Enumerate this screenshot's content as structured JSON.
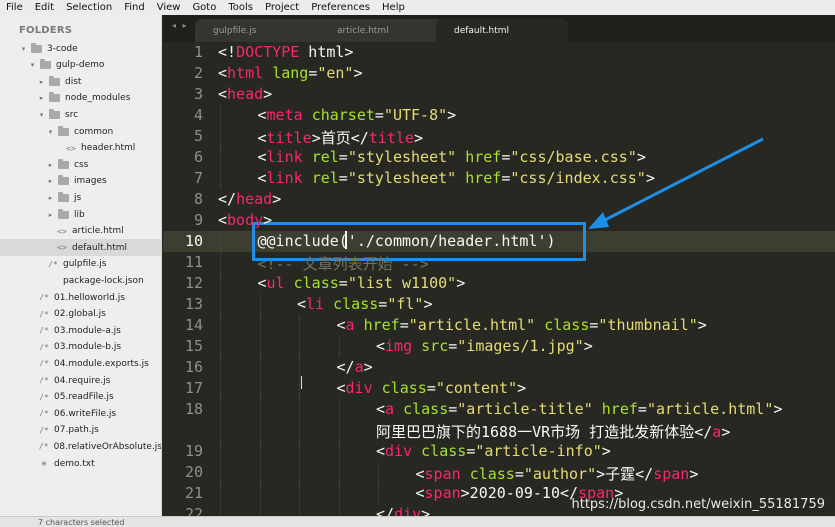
{
  "menu": [
    "File",
    "Edit",
    "Selection",
    "Find",
    "View",
    "Goto",
    "Tools",
    "Project",
    "Preferences",
    "Help"
  ],
  "sidebar": {
    "title": "FOLDERS",
    "items": [
      {
        "label": "3-code",
        "type": "folder",
        "arrow": "▾",
        "depth": 0
      },
      {
        "label": "gulp-demo",
        "type": "folder",
        "arrow": "▾",
        "depth": 1
      },
      {
        "label": "dist",
        "type": "folder",
        "arrow": "▸",
        "depth": 2
      },
      {
        "label": "node_modules",
        "type": "folder",
        "arrow": "▸",
        "depth": 2
      },
      {
        "label": "src",
        "type": "folder",
        "arrow": "▾",
        "depth": 2
      },
      {
        "label": "common",
        "type": "folder",
        "arrow": "▾",
        "depth": 3
      },
      {
        "label": "header.html",
        "type": "html",
        "icon": "<>",
        "depth": 4
      },
      {
        "label": "css",
        "type": "folder",
        "arrow": "▸",
        "depth": 3
      },
      {
        "label": "images",
        "type": "folder",
        "arrow": "▸",
        "depth": 3
      },
      {
        "label": "js",
        "type": "folder",
        "arrow": "▸",
        "depth": 3
      },
      {
        "label": "lib",
        "type": "folder",
        "arrow": "▸",
        "depth": 3
      },
      {
        "label": "article.html",
        "type": "html",
        "icon": "<>",
        "depth": 3
      },
      {
        "label": "default.html",
        "type": "html",
        "icon": "<>",
        "depth": 3,
        "selected": true
      },
      {
        "label": "gulpfile.js",
        "type": "js",
        "icon": "/*",
        "depth": 2
      },
      {
        "label": "package-lock.json",
        "type": "json",
        "icon": "",
        "depth": 2
      },
      {
        "label": "01.helloworld.js",
        "type": "js",
        "icon": "/*",
        "depth": 1
      },
      {
        "label": "02.global.js",
        "type": "js",
        "icon": "/*",
        "depth": 1
      },
      {
        "label": "03.module-a.js",
        "type": "js",
        "icon": "/*",
        "depth": 1
      },
      {
        "label": "03.module-b.js",
        "type": "js",
        "icon": "/*",
        "depth": 1
      },
      {
        "label": "04.module.exports.js",
        "type": "js",
        "icon": "/*",
        "depth": 1
      },
      {
        "label": "04.require.js",
        "type": "js",
        "icon": "/*",
        "depth": 1
      },
      {
        "label": "05.readFile.js",
        "type": "js",
        "icon": "/*",
        "depth": 1
      },
      {
        "label": "06.writeFile.js",
        "type": "js",
        "icon": "/*",
        "depth": 1
      },
      {
        "label": "07.path.js",
        "type": "js",
        "icon": "/*",
        "depth": 1
      },
      {
        "label": "08.relativeOrAbsolute.js",
        "type": "js",
        "icon": "/*",
        "depth": 1
      },
      {
        "label": "demo.txt",
        "type": "txt",
        "icon": "≡",
        "depth": 1
      }
    ]
  },
  "tabs": [
    {
      "label": "gulpfile.js",
      "active": false
    },
    {
      "label": "article.html",
      "active": false
    },
    {
      "label": "default.html",
      "active": true
    }
  ],
  "tab_nav": "◂ ▸",
  "editor": {
    "current_line": 10,
    "lines": [
      {
        "n": "1",
        "indent": 0,
        "tokens": [
          [
            "p",
            "<!"
          ],
          [
            "t",
            "DOCTYPE"
          ],
          [
            "p",
            " html>"
          ]
        ]
      },
      {
        "n": "2",
        "indent": 0,
        "tokens": [
          [
            "p",
            "<"
          ],
          [
            "t",
            "html"
          ],
          [
            "p",
            " "
          ],
          [
            "a",
            "lang"
          ],
          [
            "p",
            "="
          ],
          [
            "s",
            "\"en\""
          ],
          [
            "p",
            ">"
          ]
        ]
      },
      {
        "n": "3",
        "indent": 0,
        "tokens": [
          [
            "p",
            "<"
          ],
          [
            "t",
            "head"
          ],
          [
            "p",
            ">"
          ]
        ]
      },
      {
        "n": "4",
        "indent": 1,
        "tokens": [
          [
            "p",
            "<"
          ],
          [
            "t",
            "meta"
          ],
          [
            "p",
            " "
          ],
          [
            "a",
            "charset"
          ],
          [
            "p",
            "="
          ],
          [
            "s",
            "\"UTF-8\""
          ],
          [
            "p",
            ">"
          ]
        ]
      },
      {
        "n": "5",
        "indent": 1,
        "tokens": [
          [
            "p",
            "<"
          ],
          [
            "t",
            "title"
          ],
          [
            "p",
            ">首页</"
          ],
          [
            "t",
            "title"
          ],
          [
            "p",
            ">"
          ]
        ]
      },
      {
        "n": "6",
        "indent": 1,
        "tokens": [
          [
            "p",
            "<"
          ],
          [
            "t",
            "link"
          ],
          [
            "p",
            " "
          ],
          [
            "a",
            "rel"
          ],
          [
            "p",
            "="
          ],
          [
            "s",
            "\"stylesheet\""
          ],
          [
            "p",
            " "
          ],
          [
            "a",
            "href"
          ],
          [
            "p",
            "="
          ],
          [
            "s",
            "\"css/base.css\""
          ],
          [
            "p",
            ">"
          ]
        ]
      },
      {
        "n": "7",
        "indent": 1,
        "tokens": [
          [
            "p",
            "<"
          ],
          [
            "t",
            "link"
          ],
          [
            "p",
            " "
          ],
          [
            "a",
            "rel"
          ],
          [
            "p",
            "="
          ],
          [
            "s",
            "\"stylesheet\""
          ],
          [
            "p",
            " "
          ],
          [
            "a",
            "href"
          ],
          [
            "p",
            "="
          ],
          [
            "s",
            "\"css/index.css\""
          ],
          [
            "p",
            ">"
          ]
        ]
      },
      {
        "n": "8",
        "indent": 0,
        "tokens": [
          [
            "p",
            "</"
          ],
          [
            "t",
            "head"
          ],
          [
            "p",
            ">"
          ]
        ]
      },
      {
        "n": "9",
        "indent": 0,
        "tokens": [
          [
            "p",
            "<"
          ],
          [
            "t",
            "body"
          ],
          [
            "p",
            ">"
          ]
        ]
      },
      {
        "n": "10",
        "indent": 1,
        "tokens": [
          [
            "w",
            "@@include('./common/header.html')"
          ]
        ]
      },
      {
        "n": "11",
        "indent": 1,
        "tokens": [
          [
            "c",
            "<!-- 文章列表开始 -->"
          ]
        ]
      },
      {
        "n": "12",
        "indent": 1,
        "tokens": [
          [
            "p",
            "<"
          ],
          [
            "t",
            "ul"
          ],
          [
            "p",
            " "
          ],
          [
            "a",
            "class"
          ],
          [
            "p",
            "="
          ],
          [
            "s",
            "\"list w1100\""
          ],
          [
            "p",
            ">"
          ]
        ]
      },
      {
        "n": "13",
        "indent": 2,
        "tokens": [
          [
            "p",
            "<"
          ],
          [
            "t",
            "li"
          ],
          [
            "p",
            " "
          ],
          [
            "a",
            "class"
          ],
          [
            "p",
            "="
          ],
          [
            "s",
            "\"fl\""
          ],
          [
            "p",
            ">"
          ]
        ]
      },
      {
        "n": "14",
        "indent": 3,
        "tokens": [
          [
            "p",
            "<"
          ],
          [
            "t",
            "a"
          ],
          [
            "p",
            " "
          ],
          [
            "a",
            "href"
          ],
          [
            "p",
            "="
          ],
          [
            "s",
            "\"article.html\""
          ],
          [
            "p",
            " "
          ],
          [
            "a",
            "class"
          ],
          [
            "p",
            "="
          ],
          [
            "s",
            "\"thumbnail\""
          ],
          [
            "p",
            ">"
          ]
        ]
      },
      {
        "n": "15",
        "indent": 4,
        "tokens": [
          [
            "p",
            "<"
          ],
          [
            "t",
            "img"
          ],
          [
            "p",
            " "
          ],
          [
            "a",
            "src"
          ],
          [
            "p",
            "="
          ],
          [
            "s",
            "\"images/1.jpg\""
          ],
          [
            "p",
            ">"
          ]
        ]
      },
      {
        "n": "16",
        "indent": 3,
        "tokens": [
          [
            "p",
            "</"
          ],
          [
            "t",
            "a"
          ],
          [
            "p",
            ">"
          ]
        ]
      },
      {
        "n": "17",
        "indent": 3,
        "tokens": [
          [
            "p",
            "<"
          ],
          [
            "t",
            "div"
          ],
          [
            "p",
            " "
          ],
          [
            "a",
            "class"
          ],
          [
            "p",
            "="
          ],
          [
            "s",
            "\"content\""
          ],
          [
            "p",
            ">"
          ]
        ]
      },
      {
        "n": "18",
        "indent": 4,
        "tokens": [
          [
            "p",
            "<"
          ],
          [
            "t",
            "a"
          ],
          [
            "p",
            " "
          ],
          [
            "a",
            "class"
          ],
          [
            "p",
            "="
          ],
          [
            "s",
            "\"article-title\""
          ],
          [
            "p",
            " "
          ],
          [
            "a",
            "href"
          ],
          [
            "p",
            "="
          ],
          [
            "s",
            "\"article.html\""
          ],
          [
            "p",
            ">"
          ]
        ]
      },
      {
        "n": "",
        "indent": 4,
        "tokens": [
          [
            "p",
            "阿里巴巴旗下的1688一VR市场 打造批发新体验</"
          ],
          [
            "t",
            "a"
          ],
          [
            "p",
            ">"
          ]
        ]
      },
      {
        "n": "19",
        "indent": 4,
        "tokens": [
          [
            "p",
            "<"
          ],
          [
            "t",
            "div"
          ],
          [
            "p",
            " "
          ],
          [
            "a",
            "class"
          ],
          [
            "p",
            "="
          ],
          [
            "s",
            "\"article-info\""
          ],
          [
            "p",
            ">"
          ]
        ]
      },
      {
        "n": "20",
        "indent": 5,
        "tokens": [
          [
            "p",
            "<"
          ],
          [
            "t",
            "span"
          ],
          [
            "p",
            " "
          ],
          [
            "a",
            "class"
          ],
          [
            "p",
            "="
          ],
          [
            "s",
            "\"author\""
          ],
          [
            "p",
            ">子霆</"
          ],
          [
            "t",
            "span"
          ],
          [
            "p",
            ">"
          ]
        ]
      },
      {
        "n": "21",
        "indent": 5,
        "tokens": [
          [
            "p",
            "<"
          ],
          [
            "t",
            "span"
          ],
          [
            "p",
            ">2020-09-10</"
          ],
          [
            "t",
            "span"
          ],
          [
            "p",
            ">"
          ]
        ]
      },
      {
        "n": "22",
        "indent": 4,
        "tokens": [
          [
            "p",
            "</"
          ],
          [
            "t",
            "div"
          ],
          [
            "p",
            ">"
          ]
        ]
      }
    ]
  },
  "status": "7 characters selected",
  "watermark": "https://blog.csdn.net/weixin_55181759",
  "colors": {
    "annotation": "#1e8fe8",
    "tag": "#f92672",
    "attr": "#a6e22e",
    "string": "#e6db74",
    "comment": "#75715e"
  }
}
